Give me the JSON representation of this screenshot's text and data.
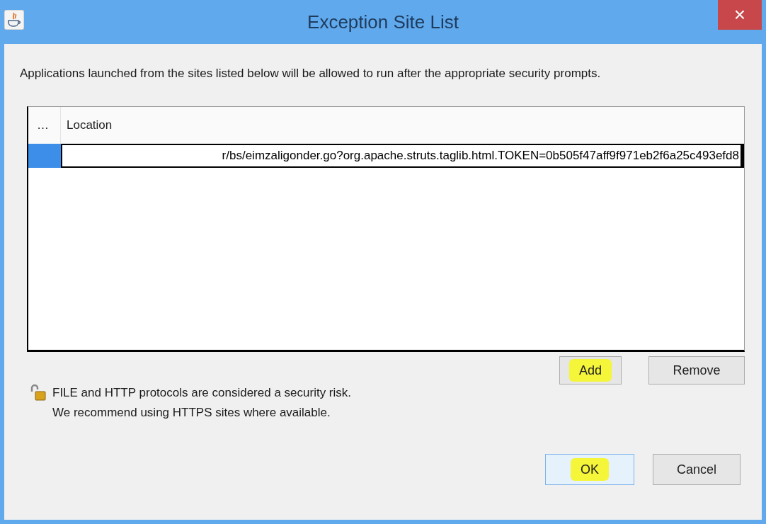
{
  "window": {
    "title": "Exception Site List",
    "close": "×"
  },
  "description": "Applications launched from the sites listed below will be allowed to run after the appropriate security prompts.",
  "table": {
    "columns": [
      "…",
      "Location"
    ],
    "rows": [
      {
        "selected": true,
        "editing": true,
        "cells": [
          "",
          "r/bs/eimzaligonder.go?org.apache.struts.taglib.html.TOKEN=0b505f47aff9f971eb2f6a25c493efd8"
        ]
      }
    ]
  },
  "list_buttons": [
    {
      "label": "Add",
      "highlighted": true,
      "focused": false
    },
    {
      "label": "Remove",
      "highlighted": false,
      "focused": false
    }
  ],
  "warning": [
    "FILE and HTTP protocols are considered a security risk.",
    "We recommend using HTTPS sites where available."
  ],
  "dialog_buttons": [
    {
      "label": "OK",
      "highlighted": true,
      "focused": true
    },
    {
      "label": "Cancel",
      "highlighted": false,
      "focused": false
    }
  ]
}
